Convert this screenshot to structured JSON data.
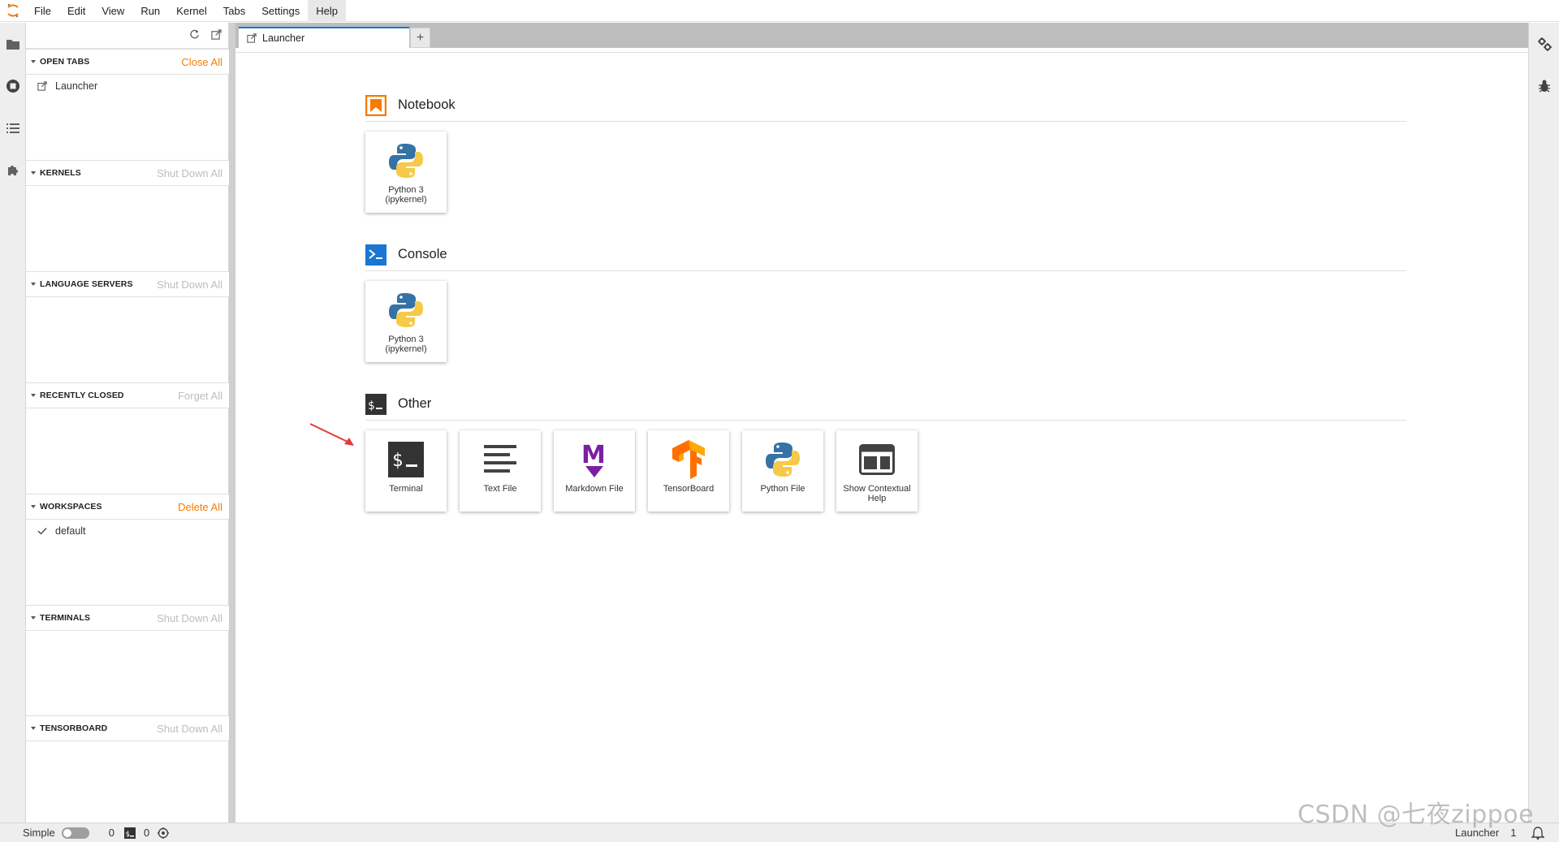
{
  "menu": {
    "items": [
      "File",
      "Edit",
      "View",
      "Run",
      "Kernel",
      "Tabs",
      "Settings",
      "Help"
    ],
    "active": "Help"
  },
  "left_activity": {
    "icons": [
      "folder-icon",
      "running-icon",
      "toc-icon",
      "extension-icon"
    ]
  },
  "running_panel": {
    "sections": {
      "open_tabs": {
        "title": "OPEN TABS",
        "action": "Close All",
        "items": [
          "Launcher"
        ]
      },
      "kernels": {
        "title": "KERNELS",
        "action": "Shut Down All"
      },
      "language_servers": {
        "title": "LANGUAGE SERVERS",
        "action": "Shut Down All"
      },
      "recently_closed": {
        "title": "RECENTLY CLOSED",
        "action": "Forget All"
      },
      "workspaces": {
        "title": "WORKSPACES",
        "action": "Delete All",
        "items": [
          "default"
        ]
      },
      "terminals": {
        "title": "TERMINALS",
        "action": "Shut Down All"
      },
      "tensorboard": {
        "title": "TENSORBOARD",
        "action": "Shut Down All"
      }
    }
  },
  "tabs": {
    "launcher_label": "Launcher",
    "add_label": "+"
  },
  "launcher": {
    "notebook": {
      "title": "Notebook",
      "cards": [
        {
          "label": "Python 3\n(ipykernel)"
        }
      ]
    },
    "console": {
      "title": "Console",
      "cards": [
        {
          "label": "Python 3\n(ipykernel)"
        }
      ]
    },
    "other": {
      "title": "Other",
      "cards": [
        {
          "label": "Terminal"
        },
        {
          "label": "Text File"
        },
        {
          "label": "Markdown File"
        },
        {
          "label": "TensorBoard"
        },
        {
          "label": "Python File"
        },
        {
          "label": "Show Contextual\nHelp"
        }
      ]
    }
  },
  "status": {
    "mode_label": "Simple",
    "kernels_count": "0",
    "terminals_count": "0",
    "right_label": "Launcher",
    "right_count": "1"
  },
  "watermark": "CSDN @七夜zippoe",
  "colors": {
    "accent_orange": "#f57c00",
    "accent_blue": "#1976d2",
    "markdown_purple": "#7b1fa2",
    "annotation_red": "#e53935"
  }
}
